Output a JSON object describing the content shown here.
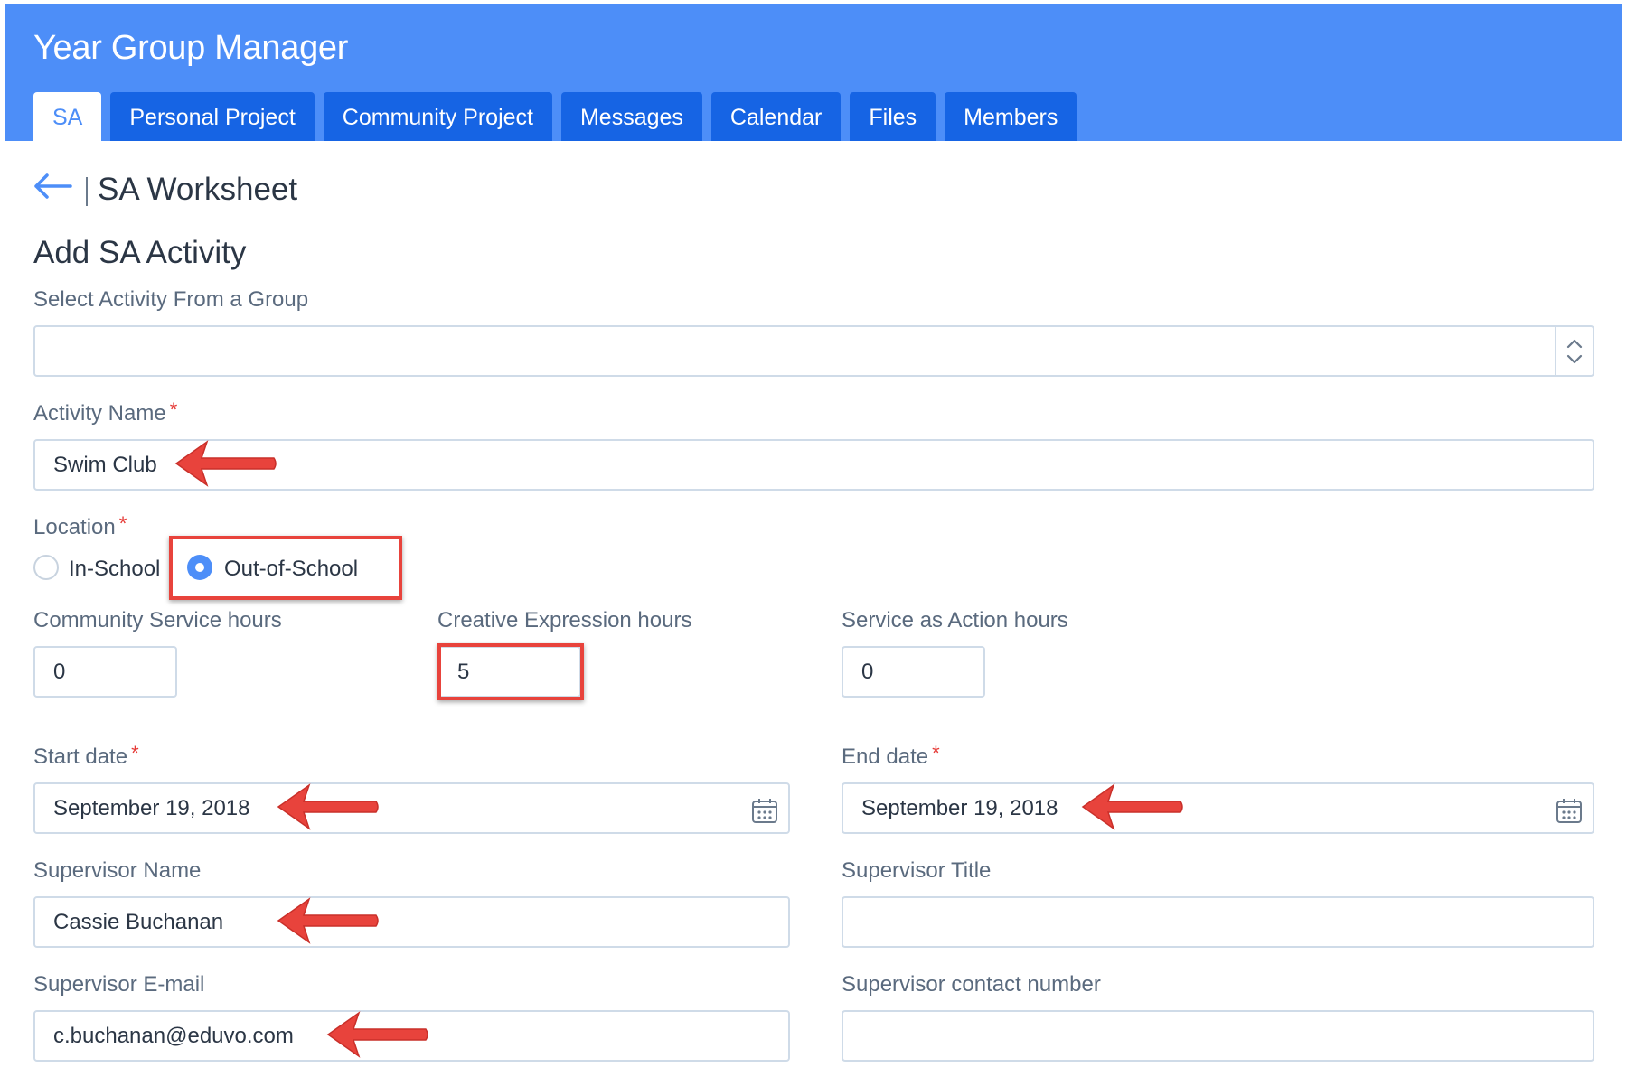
{
  "header": {
    "app_title": "Year Group Manager",
    "tabs": [
      {
        "label": "SA",
        "active": true
      },
      {
        "label": "Personal Project",
        "active": false
      },
      {
        "label": "Community Project",
        "active": false
      },
      {
        "label": "Messages",
        "active": false
      },
      {
        "label": "Calendar",
        "active": false
      },
      {
        "label": "Files",
        "active": false
      },
      {
        "label": "Members",
        "active": false
      }
    ]
  },
  "page": {
    "title": "SA Worksheet",
    "section_title": "Add SA Activity"
  },
  "form": {
    "group_select": {
      "label": "Select Activity From a Group",
      "value": ""
    },
    "activity_name": {
      "label": "Activity Name",
      "required_mark": "*",
      "value": "Swim Club"
    },
    "location": {
      "label": "Location",
      "required_mark": "*",
      "options": [
        {
          "label": "In-School",
          "selected": false
        },
        {
          "label": "Out-of-School",
          "selected": true
        }
      ]
    },
    "community_service_hours": {
      "label": "Community Service hours",
      "value": "0"
    },
    "creative_expression_hours": {
      "label": "Creative Expression hours",
      "value": "5"
    },
    "service_as_action_hours": {
      "label": "Service as Action hours",
      "value": "0"
    },
    "start_date": {
      "label": "Start date",
      "required_mark": "*",
      "value": "September 19, 2018"
    },
    "end_date": {
      "label": "End date",
      "required_mark": "*",
      "value": "September 19, 2018"
    },
    "supervisor_name": {
      "label": "Supervisor Name",
      "value": "Cassie Buchanan"
    },
    "supervisor_title": {
      "label": "Supervisor Title",
      "value": ""
    },
    "supervisor_email": {
      "label": "Supervisor E-mail",
      "value": "c.buchanan@eduvo.com"
    },
    "supervisor_contact": {
      "label": "Supervisor contact number",
      "value": ""
    }
  },
  "icons": {
    "back": "left-arrow-icon",
    "select": "chevron-up-down-icon",
    "calendar": "calendar-icon",
    "annotation": "red-pointer-arrow-icon"
  },
  "colors": {
    "header_bg": "#4d8ef8",
    "tab_bg": "#1664e4",
    "accent": "#4d8ef8",
    "required": "#e53935",
    "annotation": "#e8433c"
  }
}
